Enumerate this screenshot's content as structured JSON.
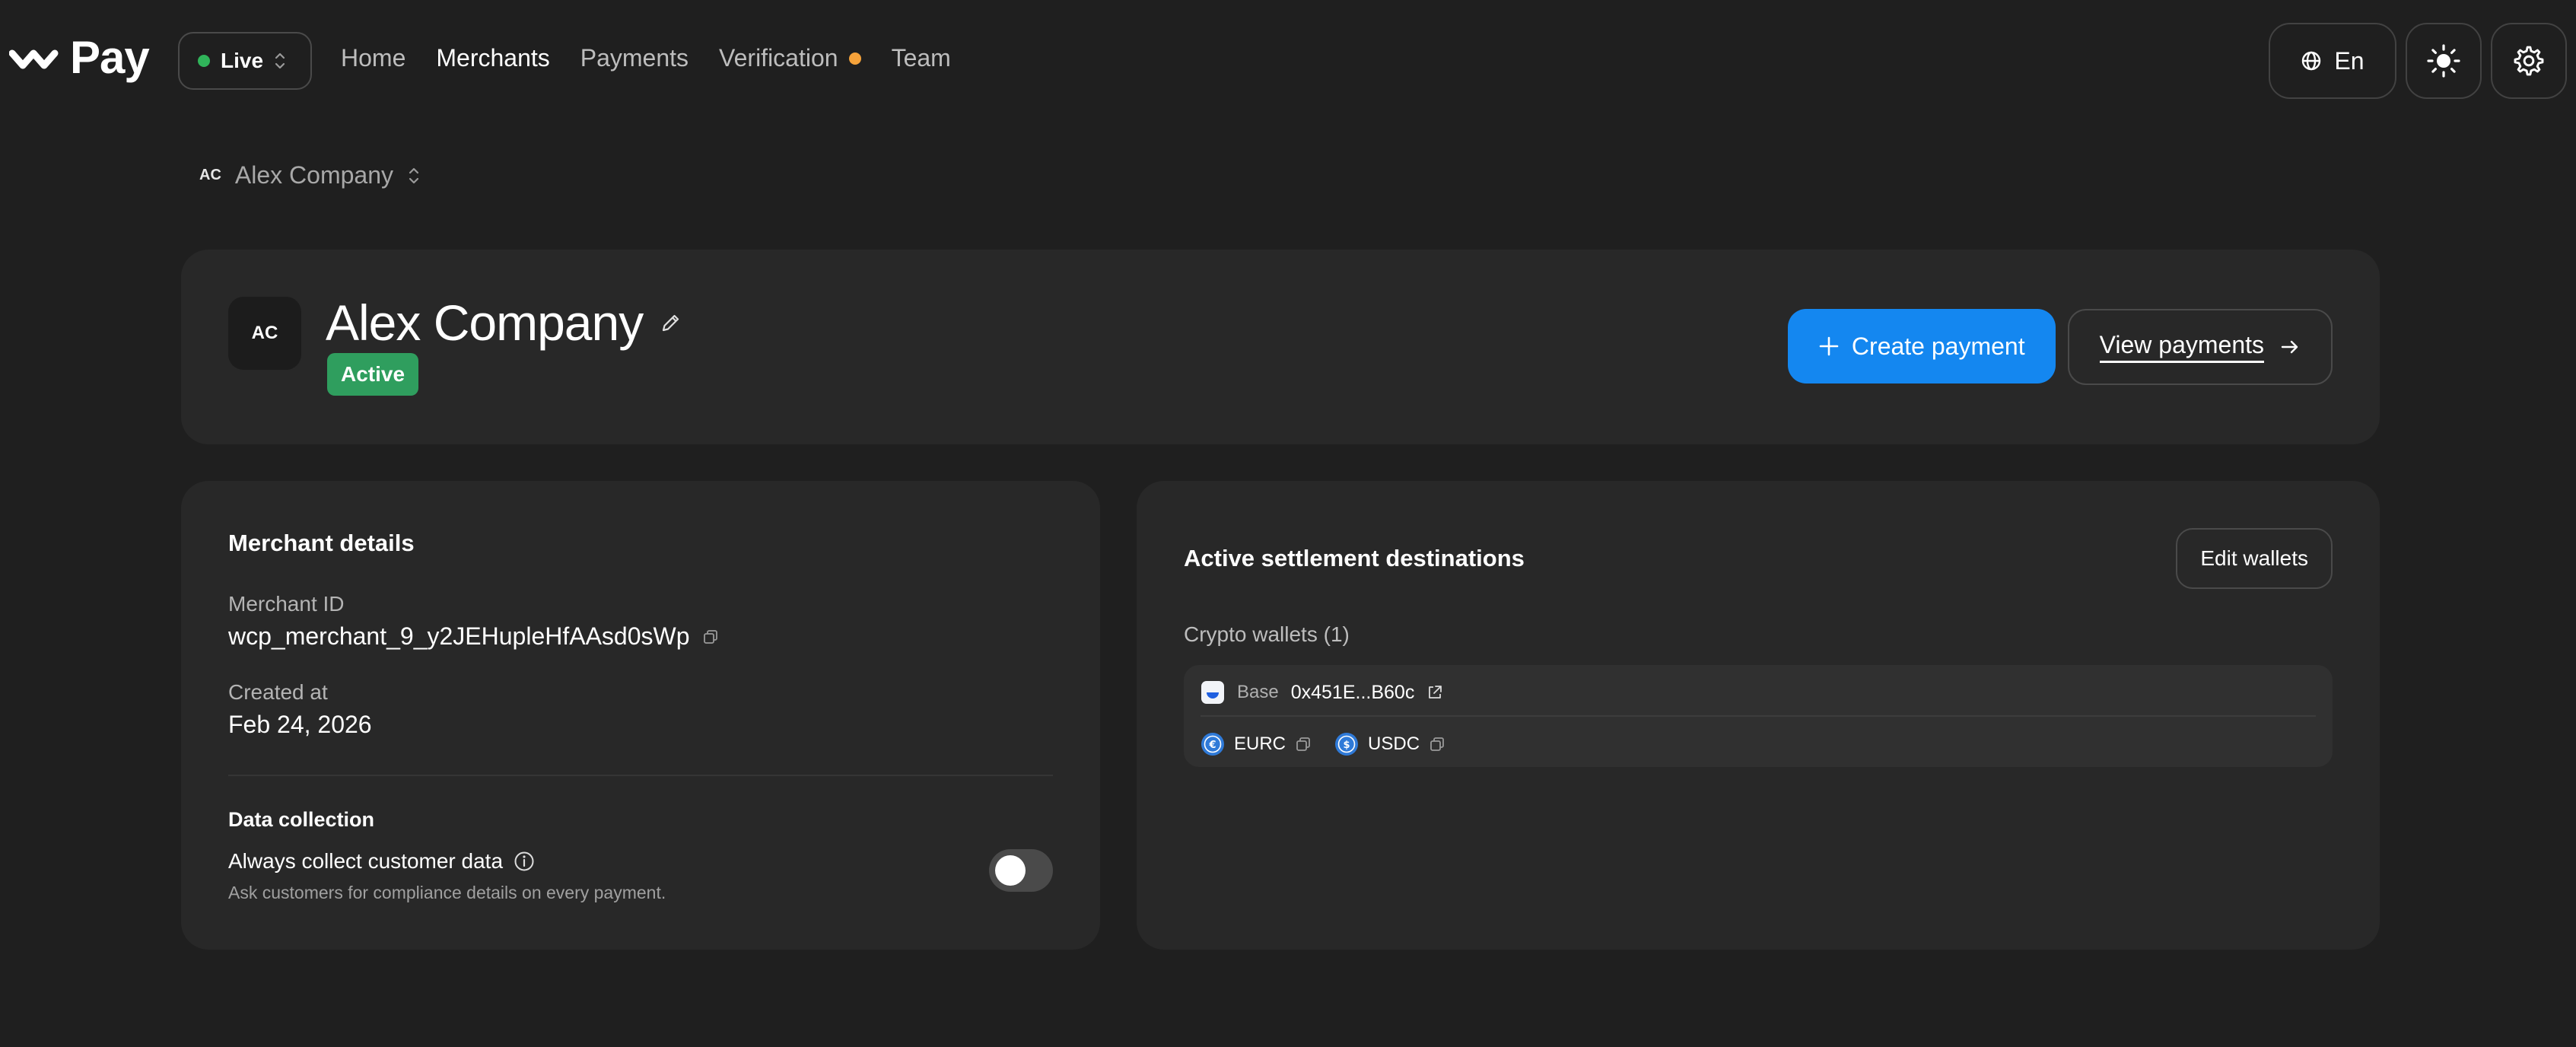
{
  "brand": {
    "name": "Pay"
  },
  "environment": {
    "label": "Live",
    "dot_color": "#30b45a"
  },
  "nav": {
    "items": [
      {
        "label": "Home",
        "active": false
      },
      {
        "label": "Merchants",
        "active": true
      },
      {
        "label": "Payments",
        "active": false
      },
      {
        "label": "Verification",
        "active": false
      },
      {
        "label": "Team",
        "active": false
      }
    ],
    "verification_badge_color": "#f5a23a"
  },
  "header_actions": {
    "language": "En",
    "icons": [
      "globe-icon",
      "sun-icon",
      "gear-icon"
    ]
  },
  "merchant_selector": {
    "initials": "AC",
    "name": "Alex Company"
  },
  "merchant": {
    "initials": "AC",
    "name": "Alex Company",
    "status": "Active",
    "status_color": "#2f9e5e",
    "create_payment_label": "Create payment",
    "view_payments_label": "View payments",
    "accent_color": "#1487f0"
  },
  "details": {
    "title": "Merchant details",
    "merchant_id_label": "Merchant ID",
    "merchant_id": "wcp_merchant_9_y2JEHupleHfAAsd0sWp",
    "created_label": "Created at",
    "created_value": "Feb 24, 2026",
    "data_collection_title": "Data collection",
    "always_collect_label": "Always collect customer data",
    "always_collect_desc": "Ask customers for compliance details on every payment.",
    "always_collect_enabled": false
  },
  "settlement": {
    "title": "Active settlement destinations",
    "edit_label": "Edit wallets",
    "wallets_label": "Crypto wallets (1)",
    "wallets": [
      {
        "network": "Base",
        "address": "0x451E...B60c",
        "tokens": [
          "EURC",
          "USDC"
        ]
      }
    ]
  }
}
